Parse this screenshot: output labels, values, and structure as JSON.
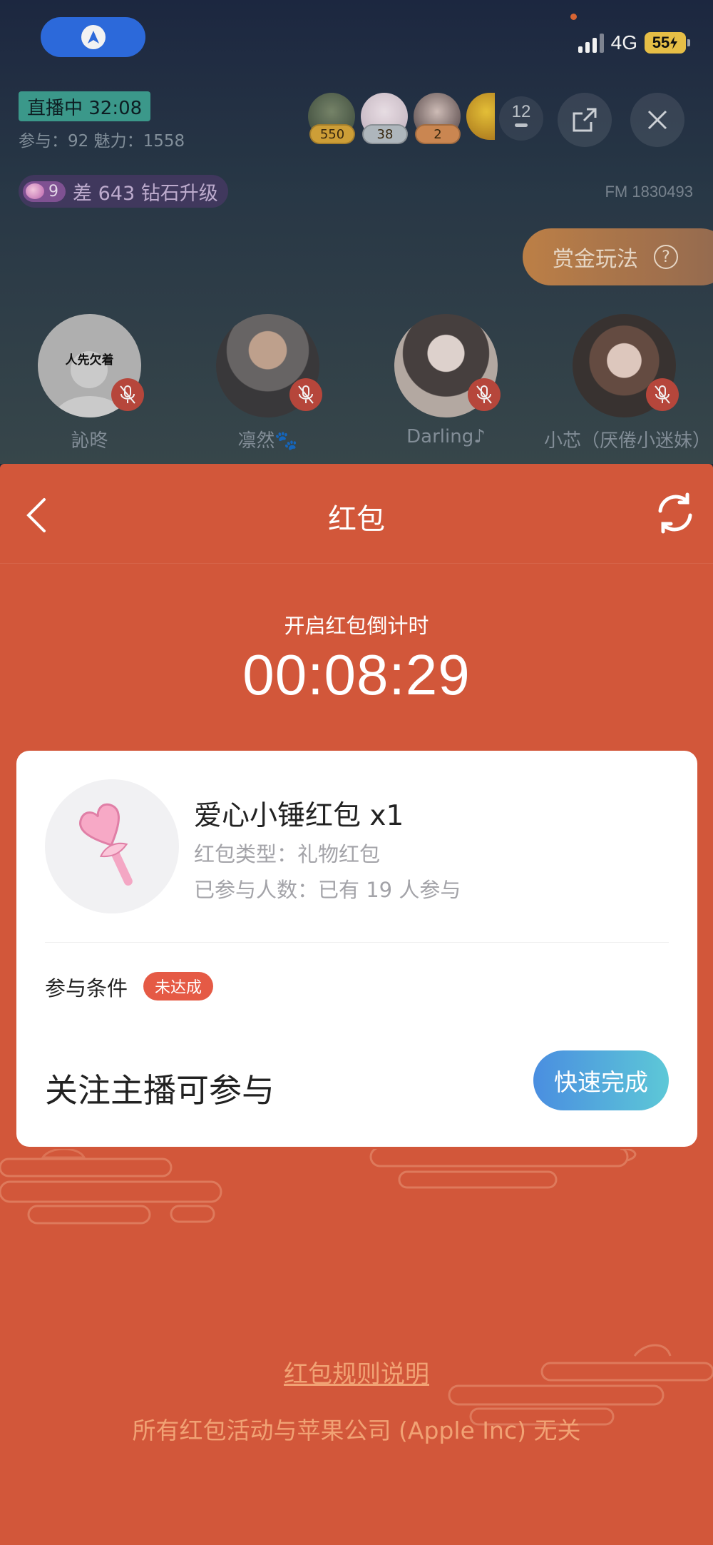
{
  "status_bar": {
    "network": "4G",
    "battery": "55"
  },
  "room": {
    "live_badge": "直播中 32:08",
    "stats": "参与：92 魅力：1558",
    "viewers": [
      {
        "count": "550",
        "color": "#d9a73a"
      },
      {
        "count": "38",
        "color": "#b8c0c7"
      },
      {
        "count": "2",
        "color": "#d58e56"
      }
    ],
    "viewers_more": "12",
    "level": "9",
    "level_hint": "差 643 钻石升级",
    "fm_id": "FM 1830493",
    "bounty_label": "赏金玩法",
    "seats": [
      {
        "name": "訫昸",
        "avatar_text": "人先欠着"
      },
      {
        "name": "凛然🐾"
      },
      {
        "name": "Darling♪"
      },
      {
        "name": "小芯（厌倦小迷妹）"
      }
    ]
  },
  "packet": {
    "title": "红包",
    "countdown_label": "开启红包倒计时",
    "countdown": "00:08:29",
    "gift_name": "爱心小锤红包 x1",
    "gift_type": "红包类型：礼物红包",
    "participants": "已参与人数：已有 19 人参与",
    "condition_label": "参与条件",
    "condition_status": "未达成",
    "condition_text": "关注主播可参与",
    "quick_button": "快速完成",
    "rules_link": "红包规则说明",
    "disclaimer": "所有红包活动与苹果公司 (Apple Inc) 无关"
  },
  "colors": {
    "sheet_bg": "#d2573a",
    "link": "#f1a274",
    "badge": "#e55a45",
    "button_start": "#4a8ee0",
    "button_end": "#5dc8d7"
  }
}
